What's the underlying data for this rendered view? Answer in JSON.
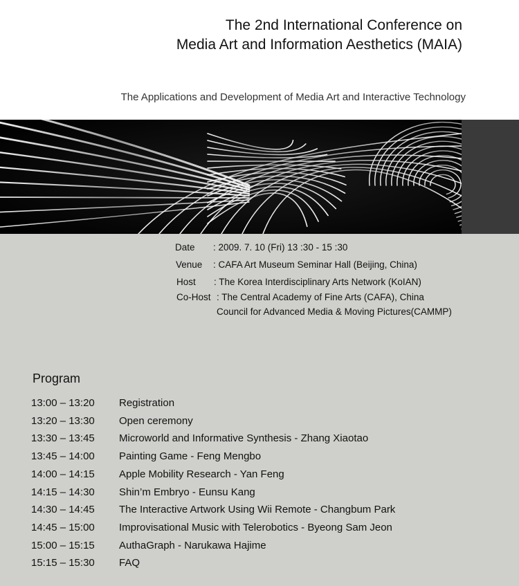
{
  "header": {
    "title_line1": "The 2nd International Conference on",
    "title_line2": "Media Art and Information Aesthetics (MAIA)",
    "subtitle": "The Applications and  Development of Media Art and Interactive Technology"
  },
  "info": {
    "date_label": "Date",
    "date_value": ": 2009. 7. 10 (Fri) 13 :30 - 15 :30",
    "venue_label": "Venue",
    "venue_value": ": CAFA Art Museum Seminar Hall (Beijing, China)",
    "host_label": "Host",
    "host_value": ": The Korea Interdisciplinary Arts Network (KoIAN)",
    "cohost_label": "Co-Host",
    "cohost_value1": ": The Central Academy of Fine Arts (CAFA), China",
    "cohost_value2": "Council for Advanced Media & Moving Pictures(CAMMP)"
  },
  "program": {
    "title": "Program",
    "rows": [
      {
        "time": "13:00 – 13:20",
        "item": "Registration"
      },
      {
        "time": "13:20 – 13:30",
        "item": "Open ceremony"
      },
      {
        "time": "13:30 – 13:45",
        "item": "Microworld and Informative Synthesis  - Zhang Xiaotao"
      },
      {
        "time": "13:45 – 14:00",
        "item": "Painting Game - Feng Mengbo"
      },
      {
        "time": "14:00 – 14:15",
        "item": "Apple Mobility Research - Yan Feng"
      },
      {
        "time": "14:15 – 14:30",
        "item": "Shin’m Embryo - Eunsu Kang"
      },
      {
        "time": "14:30 – 14:45",
        "item": "The Interactive Artwork Using Wii Remote - Changbum Park"
      },
      {
        "time": "14:45 – 15:00",
        "item": "Improvisational Music with Telerobotics - Byeong Sam Jeon"
      },
      {
        "time": "15:00 – 15:15",
        "item": "AuthaGraph - Narukawa Hajime"
      },
      {
        "time": "15:15 – 15:30",
        "item": "FAQ"
      }
    ]
  }
}
